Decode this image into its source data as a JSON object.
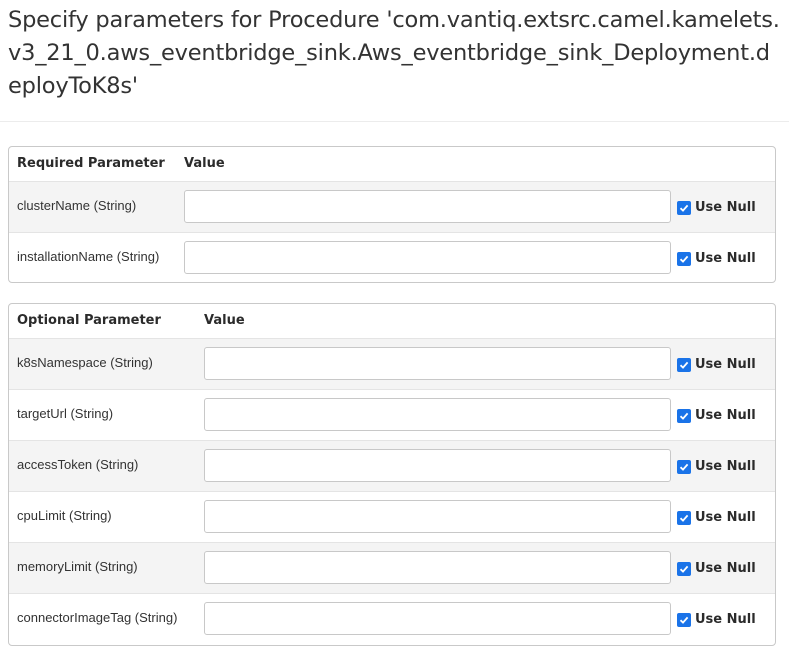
{
  "page": {
    "title": "Specify parameters for Procedure 'com.vantiq.extsrc.camel.kamelets.v3_21_0.aws_eventbridge_sink.Aws_eventbridge_sink_Deployment.deployToK8s'"
  },
  "required": {
    "header_param": "Required Parameter",
    "header_value": "Value",
    "rows": [
      {
        "label": "clusterName (String)",
        "value": "",
        "use_null_label": "Use Null",
        "use_null_checked": true
      },
      {
        "label": "installationName (String)",
        "value": "",
        "use_null_label": "Use Null",
        "use_null_checked": true
      }
    ]
  },
  "optional": {
    "header_param": "Optional Parameter",
    "header_value": "Value",
    "rows": [
      {
        "label": "k8sNamespace (String)",
        "value": "",
        "use_null_label": "Use Null",
        "use_null_checked": true
      },
      {
        "label": "targetUrl (String)",
        "value": "",
        "use_null_label": "Use Null",
        "use_null_checked": true
      },
      {
        "label": "accessToken (String)",
        "value": "",
        "use_null_label": "Use Null",
        "use_null_checked": true
      },
      {
        "label": "cpuLimit (String)",
        "value": "",
        "use_null_label": "Use Null",
        "use_null_checked": true
      },
      {
        "label": "memoryLimit (String)",
        "value": "",
        "use_null_label": "Use Null",
        "use_null_checked": true
      },
      {
        "label": "connectorImageTag (String)",
        "value": "",
        "use_null_label": "Use Null",
        "use_null_checked": true
      }
    ]
  },
  "colors": {
    "accent": "#1a73e8",
    "border": "#c9c9c9",
    "row_shade": "#f4f4f4"
  }
}
